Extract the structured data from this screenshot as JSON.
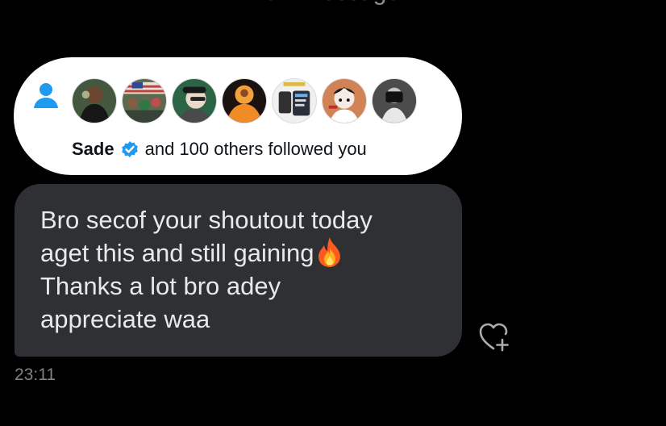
{
  "header": {
    "partial_label": "New message"
  },
  "follow_notification": {
    "icon": "person-icon",
    "avatars": [
      {
        "name": "avatar-1",
        "color": "#3a3f36"
      },
      {
        "name": "avatar-2",
        "color": "#687a59"
      },
      {
        "name": "avatar-3",
        "color": "#2c6546"
      },
      {
        "name": "avatar-4",
        "color": "#ec9835"
      },
      {
        "name": "avatar-5",
        "color": "#e6e6e6"
      },
      {
        "name": "avatar-6",
        "color": "#c97a56"
      },
      {
        "name": "avatar-7",
        "color": "#4f4f4f"
      }
    ],
    "name": "Sade",
    "verified_icon": "verified-badge-icon",
    "text": "and 100 others followed you"
  },
  "message": {
    "lines": [
      "Bro secof your shoutout today",
      "aget this and still gaining",
      "Thanks a lot bro adey",
      "appreciate waa"
    ],
    "emoji": "fire-icon"
  },
  "reaction_icon": "heart-plus-icon",
  "timestamp": "23:11",
  "colors": {
    "background": "#000000",
    "bubble": "#2f3034",
    "attachment": "#ffffff",
    "accent": "#1d9bf0",
    "muted": "#7f8388"
  }
}
